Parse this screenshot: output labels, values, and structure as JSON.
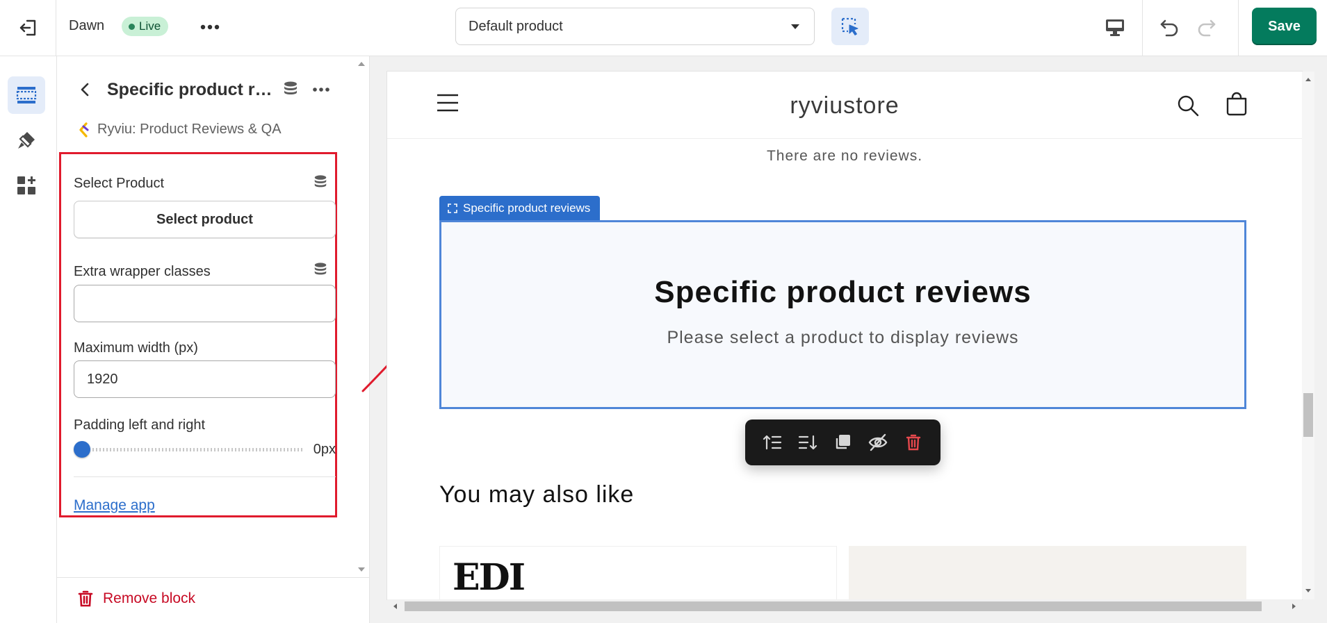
{
  "topbar": {
    "exit_icon": "exit-icon",
    "theme_name": "Dawn",
    "live_badge": "Live",
    "template_select": {
      "value": "Default product"
    },
    "save_label": "Save"
  },
  "rail": {
    "items": [
      {
        "icon": "sections-icon",
        "active": true
      },
      {
        "icon": "theme-settings-icon",
        "active": false
      },
      {
        "icon": "app-embeds-icon",
        "active": false
      }
    ]
  },
  "panel": {
    "title": "Specific product reviews",
    "app_name": "Ryviu: Product Reviews & QA",
    "fields": {
      "select_product": {
        "label": "Select Product",
        "button": "Select product"
      },
      "extra_wrapper": {
        "label": "Extra wrapper classes",
        "value": ""
      },
      "max_width": {
        "label": "Maximum width (px)",
        "value": "1920"
      },
      "padding": {
        "label": "Padding left and right",
        "value": "0px",
        "level": 0
      }
    },
    "manage_link": "Manage app",
    "remove_label": "Remove block"
  },
  "preview": {
    "store_name": "ryviustore",
    "no_reviews": "There are no reviews.",
    "block_tag": "Specific product reviews",
    "block_heading": "Specific product reviews",
    "block_sub": "Please select a product to display reviews",
    "also_like": "You may also like",
    "card_logo": "EDI"
  },
  "colors": {
    "save": "#047b5d",
    "live_badge_bg": "#c9f0d6",
    "selection_blue": "#2c6ecb",
    "highlight_red": "#e01b2d",
    "remove_red": "#c70a24"
  }
}
